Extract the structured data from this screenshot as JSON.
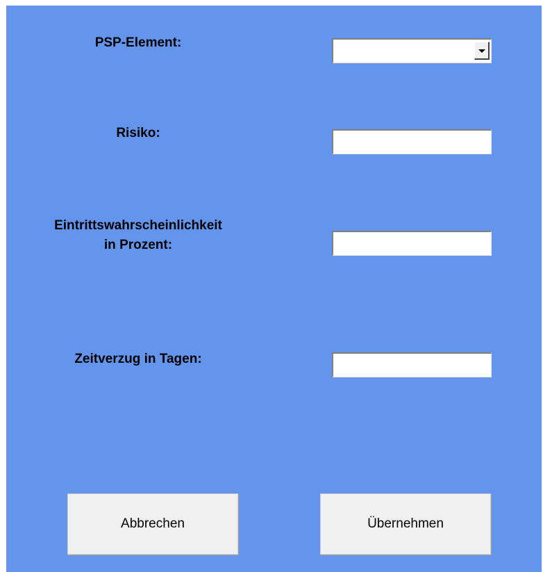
{
  "form": {
    "psp_element": {
      "label": "PSP-Element:",
      "selected_value": ""
    },
    "risiko": {
      "label": "Risiko:",
      "value": ""
    },
    "eintrittswahrscheinlichkeit": {
      "label_line1": "Eintrittswahrscheinlichkeit",
      "label_line2": "in Prozent:",
      "value": ""
    },
    "zeitverzug": {
      "label": "Zeitverzug in Tagen:",
      "value": ""
    }
  },
  "buttons": {
    "cancel_label": "Abbrechen",
    "apply_label": "Übernehmen"
  },
  "colors": {
    "panel_background": "#6495ed",
    "button_background": "#f0f0f0"
  },
  "icons": {
    "dropdown": "chevron-down-icon"
  }
}
